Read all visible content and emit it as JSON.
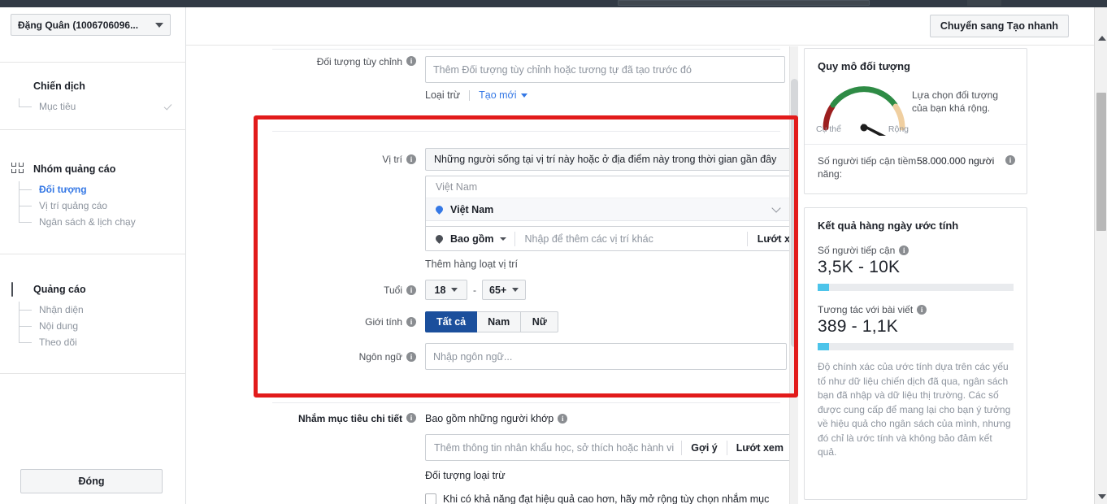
{
  "browser": {
    "window_title": ""
  },
  "sidebar": {
    "account_select": "Đặng Quân (1006706096...",
    "sections": [
      {
        "name": "campaign",
        "icon": "checkbox-icon",
        "title": "Chiến dịch",
        "items": [
          {
            "label": "Mục tiêu",
            "state": "done",
            "active": false
          }
        ]
      },
      {
        "name": "adset",
        "icon": "grid-icon",
        "title": "Nhóm quảng cáo",
        "items": [
          {
            "label": "Đối tượng",
            "state": "",
            "active": true
          },
          {
            "label": "Vị trí quảng cáo",
            "state": "",
            "active": false
          },
          {
            "label": "Ngân sách & lịch chạy",
            "state": "",
            "active": false
          }
        ]
      },
      {
        "name": "ad",
        "icon": "screen-icon",
        "title": "Quảng cáo",
        "items": [
          {
            "label": "Nhận diện",
            "state": "",
            "active": false
          },
          {
            "label": "Nội dung",
            "state": "",
            "active": false
          },
          {
            "label": "Theo dõi",
            "state": "",
            "active": false
          }
        ]
      }
    ],
    "close_button": "Đóng"
  },
  "topbar": {
    "switch_button": "Chuyển sang Tạo nhanh"
  },
  "form": {
    "custom_audience": {
      "label": "Đối tượng tùy chỉnh",
      "placeholder": "Thêm Đối tượng tùy chỉnh hoặc tương tự đã tạo trước đó",
      "exclude_link": "Loại trừ",
      "create_new_link": "Tạo mới"
    },
    "location": {
      "label": "Vị trí",
      "dropdown_value": "Những người sống tại vị trí này hoặc ở địa điểm này trong thời gian gần đây",
      "search_title": "Việt Nam",
      "selected": [
        {
          "name": "Việt Nam",
          "pin": "location-pin-icon"
        }
      ],
      "include_label": "Bao gồm",
      "add_placeholder": "Nhập để thêm các vị trí khác",
      "browse_label": "Lướt xem",
      "bulk_link": "Thêm hàng loạt vị trí"
    },
    "age": {
      "label": "Tuổi",
      "min": "18",
      "sep": "-",
      "max": "65+"
    },
    "gender": {
      "label": "Giới tính",
      "options": [
        {
          "label": "Tất cả",
          "selected": true
        },
        {
          "label": "Nam",
          "selected": false
        },
        {
          "label": "Nữ",
          "selected": false
        }
      ]
    },
    "language": {
      "label": "Ngôn ngữ",
      "placeholder": "Nhập ngôn ngữ..."
    },
    "detailed_targeting": {
      "label": "Nhắm mục tiêu chi tiết",
      "include_title": "Bao gồm những người khớp",
      "placeholder": "Thêm thông tin nhân khẩu học, sở thích hoặc hành vi",
      "suggest_label": "Gợi ý",
      "browse_label": "Lướt xem",
      "exclude_title": "Đối tượng loại trừ",
      "expand_checkbox_label": "Khi có khả năng đạt hiệu quả cao hơn, hãy mở rộng tùy chọn nhắm mục"
    }
  },
  "right_panel": {
    "audience_size": {
      "title": "Quy mô đối tượng",
      "gauge": {
        "left_label": "Cụ thể",
        "right_label": "Rộng",
        "needle_angle_deg": 42,
        "colors": {
          "low": "#9c1f1f",
          "mid": "#2e8b45",
          "high": "#f0cfa0"
        }
      },
      "note": "Lựa chọn đối tượng của bạn khá rộng.",
      "reach_key": "Số người tiếp cận tiềm năng:",
      "reach_value": "58.000.000 người"
    },
    "daily_results": {
      "title": "Kết quả hàng ngày ước tính",
      "metrics": [
        {
          "label": "Số người tiếp cận",
          "value": "3,5K - 10K",
          "bar_percent": 6
        },
        {
          "label": "Tương tác với bài viết",
          "value": "389 - 1,1K",
          "bar_percent": 6
        }
      ],
      "disclaimer": "Độ chính xác của ước tính dựa trên các yếu tố như dữ liệu chiến dịch đã qua, ngân sách bạn đã nhập và dữ liệu thị trường. Các số được cung cấp để mang lại cho bạn ý tưởng về hiệu quả cho ngân sách của mình, nhưng đó chỉ là ước tính và không bảo đảm kết quả."
    }
  },
  "annotation": {
    "highlight_color": "#e21b1b"
  }
}
